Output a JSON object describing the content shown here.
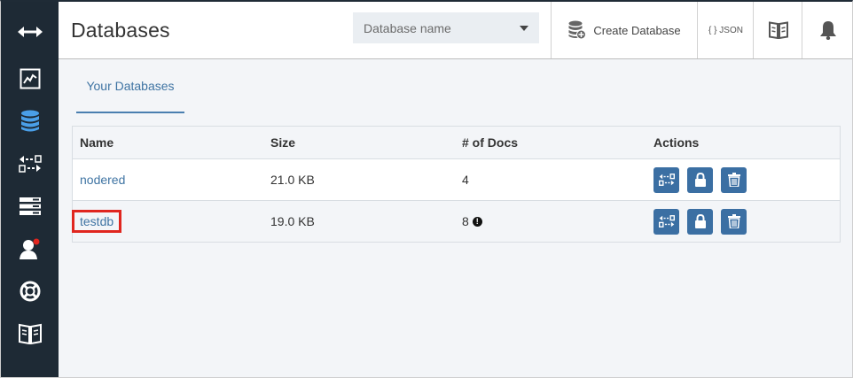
{
  "header": {
    "title": "Databases",
    "db_select_placeholder": "Database name",
    "create_label": "Create Database",
    "json_label": "{ } JSON"
  },
  "sidebar": {
    "items": [
      {
        "icon": "expand-arrows-icon"
      },
      {
        "icon": "activity-chart-icon"
      },
      {
        "icon": "database-icon",
        "active": true
      },
      {
        "icon": "replication-icon"
      },
      {
        "icon": "server-list-icon"
      },
      {
        "icon": "user-notification-icon"
      },
      {
        "icon": "lifebuoy-icon"
      },
      {
        "icon": "open-book-icon"
      }
    ]
  },
  "tabs": [
    "Your Databases"
  ],
  "table": {
    "columns": [
      "Name",
      "Size",
      "# of Docs",
      "Actions"
    ],
    "rows": [
      {
        "name": "nodered",
        "size": "21.0 KB",
        "docs": "4"
      },
      {
        "name": "testdb",
        "size": "19.0 KB",
        "docs": "8",
        "warning": true
      }
    ]
  },
  "colors": {
    "sidebar_bg": "#1e2a35",
    "accent": "#3b6fa3",
    "highlight": "#e0261f"
  }
}
